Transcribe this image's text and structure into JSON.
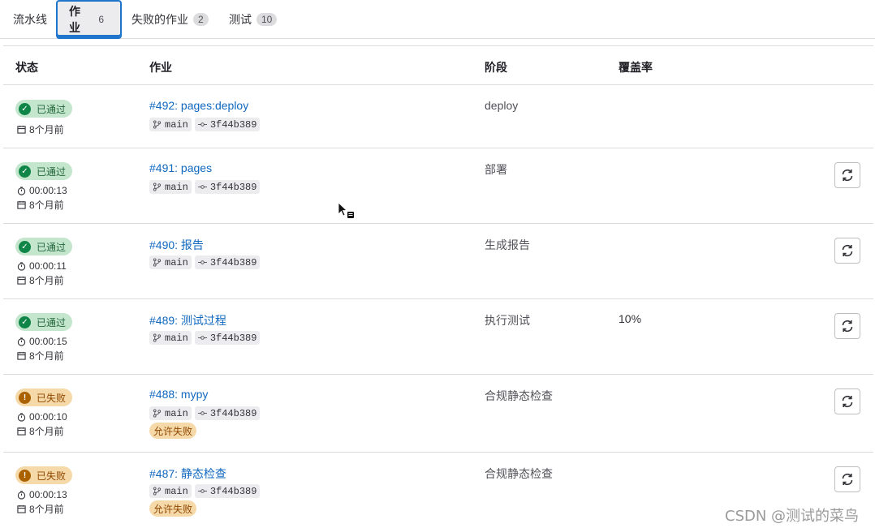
{
  "tabs": [
    {
      "label": "流水线",
      "count": ""
    },
    {
      "label": "作业",
      "count": "6"
    },
    {
      "label": "失败的作业",
      "count": "2"
    },
    {
      "label": "测试",
      "count": "10"
    }
  ],
  "columns": {
    "status": "状态",
    "job": "作业",
    "stage": "阶段",
    "coverage": "覆盖率"
  },
  "jobs": [
    {
      "status": "已通过",
      "duration": "",
      "age": "8个月前",
      "link": "#492: pages:deploy",
      "branch": "main",
      "commit": "3f44b389",
      "allow": "",
      "stage": "deploy",
      "coverage": ""
    },
    {
      "status": "已通过",
      "duration": "00:00:13",
      "age": "8个月前",
      "link": "#491: pages",
      "branch": "main",
      "commit": "3f44b389",
      "allow": "",
      "stage": "部署",
      "coverage": ""
    },
    {
      "status": "已通过",
      "duration": "00:00:11",
      "age": "8个月前",
      "link": "#490: 报告",
      "branch": "main",
      "commit": "3f44b389",
      "allow": "",
      "stage": "生成报告",
      "coverage": ""
    },
    {
      "status": "已通过",
      "duration": "00:00:15",
      "age": "8个月前",
      "link": "#489: 测试过程",
      "branch": "main",
      "commit": "3f44b389",
      "allow": "",
      "stage": "执行测试",
      "coverage": "10%"
    },
    {
      "status": "已失败",
      "duration": "00:00:10",
      "age": "8个月前",
      "link": "#488: mypy",
      "branch": "main",
      "commit": "3f44b389",
      "allow": "允许失败",
      "stage": "合规静态检查",
      "coverage": ""
    },
    {
      "status": "已失败",
      "duration": "00:00:13",
      "age": "8个月前",
      "link": "#487: 静态检查",
      "branch": "main",
      "commit": "3f44b389",
      "allow": "允许失败",
      "stage": "合规静态检查",
      "coverage": ""
    }
  ],
  "watermark": "CSDN @测试的菜鸟",
  "colors": {
    "success_bg": "#c3e6cd",
    "success": "#108548",
    "failed_bg": "#f5d9a8",
    "failed": "#ab6100",
    "link": "#1068bf",
    "active_tab": "#1f75cb"
  }
}
